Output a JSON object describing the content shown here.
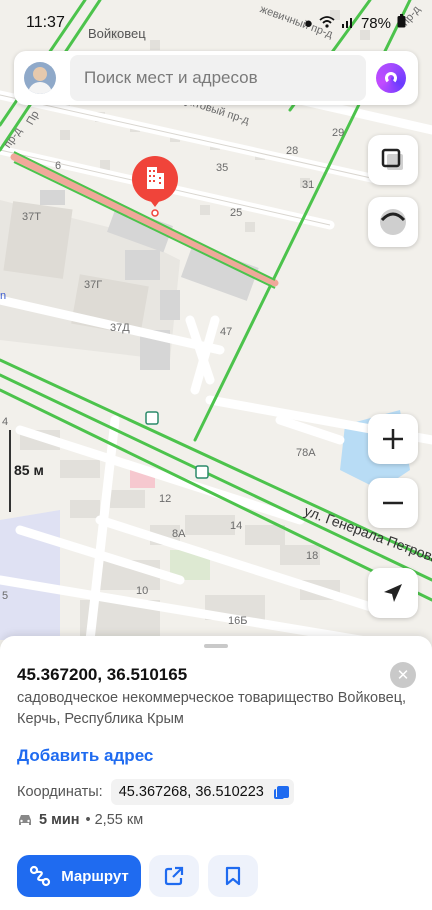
{
  "status_bar": {
    "time": "11:37",
    "battery": "78%"
  },
  "search": {
    "placeholder": "Поиск мест и адресов"
  },
  "map": {
    "labels": {
      "voykovets": "Войковец",
      "fruktovy": "руктовый пр-д",
      "zhevichny": "жевичный пр-д",
      "pr_d": "пр-д",
      "pr_d_left": "пр-д",
      "pr_left": "Пр",
      "b37t": "37Т",
      "b37g": "37Г",
      "b37d": "37Д",
      "b47": "47",
      "n6": "6",
      "n35": "35",
      "n25": "25",
      "n28": "28",
      "n29": "29",
      "n31": "31",
      "n78a": "78А",
      "n12": "12",
      "n8a": "8А",
      "n14": "14",
      "n18": "18",
      "n10": "10",
      "n16b": "16Б",
      "n4": "4",
      "n5": "5",
      "edge_n": "n",
      "street": "ул. Генерала Петрова"
    },
    "scale": "85 м",
    "colors": {
      "road_green": "#4cc34c",
      "selected_road": "#f0a89a",
      "pin_red": "#f0443a",
      "water": "#b8dcf5"
    }
  },
  "sheet": {
    "coordinates_title": "45.367200, 36.510165",
    "address": "садоводческое некоммерческое товарищество Войковец, Керчь, Республика Крым",
    "add_address": "Добавить адрес",
    "coords_label": "Координаты:",
    "coords_value": "45.367268, 36.510223",
    "eta_time": "5 мин",
    "eta_distance": "• 2,55 км",
    "route_label": "Маршрут"
  }
}
